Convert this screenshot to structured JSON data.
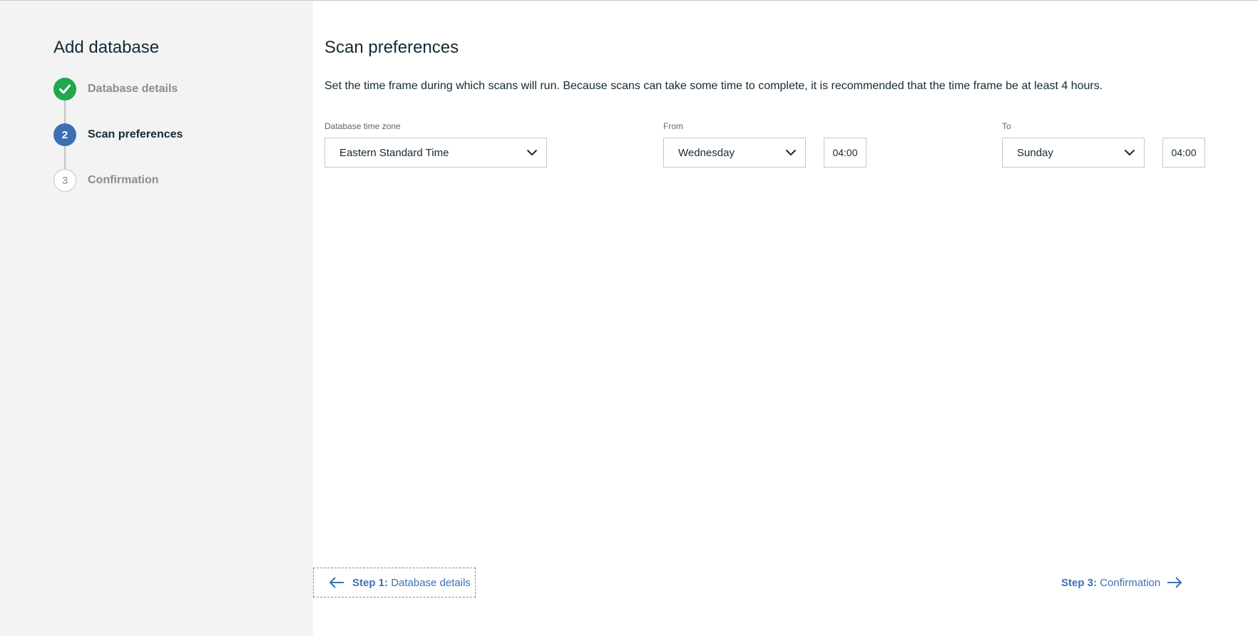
{
  "sidebar": {
    "title": "Add database",
    "steps": [
      {
        "number": "",
        "label": "Database details",
        "state": "complete"
      },
      {
        "number": "2",
        "label": "Scan preferences",
        "state": "current"
      },
      {
        "number": "3",
        "label": "Confirmation",
        "state": "future"
      }
    ]
  },
  "main": {
    "title": "Scan preferences",
    "description": "Set the time frame during which scans will run. Because scans can take some time to complete, it is recommended that the time frame be at least 4 hours.",
    "timezone": {
      "label": "Database time zone",
      "value": "Eastern Standard Time"
    },
    "from": {
      "label": "From",
      "day": "Wednesday",
      "time": "04:00"
    },
    "to": {
      "label": "To",
      "day": "Sunday",
      "time": "04:00"
    }
  },
  "nav": {
    "prev_step": "Step 1:",
    "prev_label": "Database details",
    "next_step": "Step 3:",
    "next_label": "Confirmation"
  },
  "colors": {
    "complete": "#1fa84c",
    "current": "#3d70b2",
    "link": "#3d70b2",
    "sidebar_bg": "#f3f3f3"
  },
  "icons": [
    "checkmark-icon",
    "chevron-down-icon",
    "arrow-left-icon",
    "arrow-right-icon"
  ]
}
